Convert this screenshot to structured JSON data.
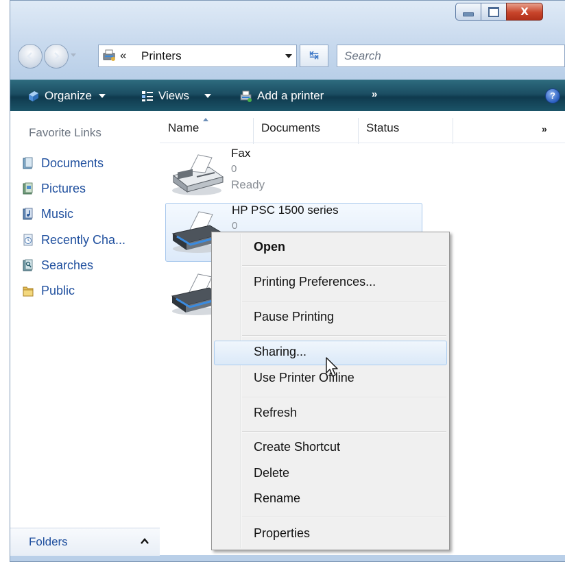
{
  "window": {
    "address": {
      "chevron": "«",
      "location": "Printers"
    },
    "search": {
      "placeholder": "Search"
    },
    "caption": {
      "close_glyph": "X"
    }
  },
  "command_bar": {
    "organize": "Organize",
    "views": "Views",
    "add_printer": "Add a printer",
    "overflow": "»",
    "help": "?"
  },
  "nav_pane": {
    "heading": "Favorite Links",
    "items": [
      {
        "label": "Documents",
        "icon": "documents-icon"
      },
      {
        "label": "Pictures",
        "icon": "pictures-icon"
      },
      {
        "label": "Music",
        "icon": "music-icon"
      },
      {
        "label": "Recently Cha...",
        "icon": "recently-changed-icon"
      },
      {
        "label": "Searches",
        "icon": "searches-icon"
      },
      {
        "label": "Public",
        "icon": "public-folder-icon"
      }
    ],
    "folders": "Folders"
  },
  "columns": {
    "name": "Name",
    "documents": "Documents",
    "status": "Status",
    "overflow": "»"
  },
  "printers": [
    {
      "name": "Fax",
      "documents": "0",
      "status": "Ready"
    },
    {
      "name": "HP PSC 1500 series",
      "documents": "0",
      "status": ""
    }
  ],
  "context_menu": {
    "items": [
      "Open",
      "Printing Preferences...",
      "Pause Printing",
      "Sharing...",
      "Use Printer Offline",
      "Refresh",
      "Create Shortcut",
      "Delete",
      "Rename",
      "Properties"
    ],
    "default_item": "Open",
    "hovered_item": "Sharing..."
  },
  "colors": {
    "link": "#1f4f9e",
    "command_bar": "#1b4d62",
    "selection": "#ddeafa"
  }
}
